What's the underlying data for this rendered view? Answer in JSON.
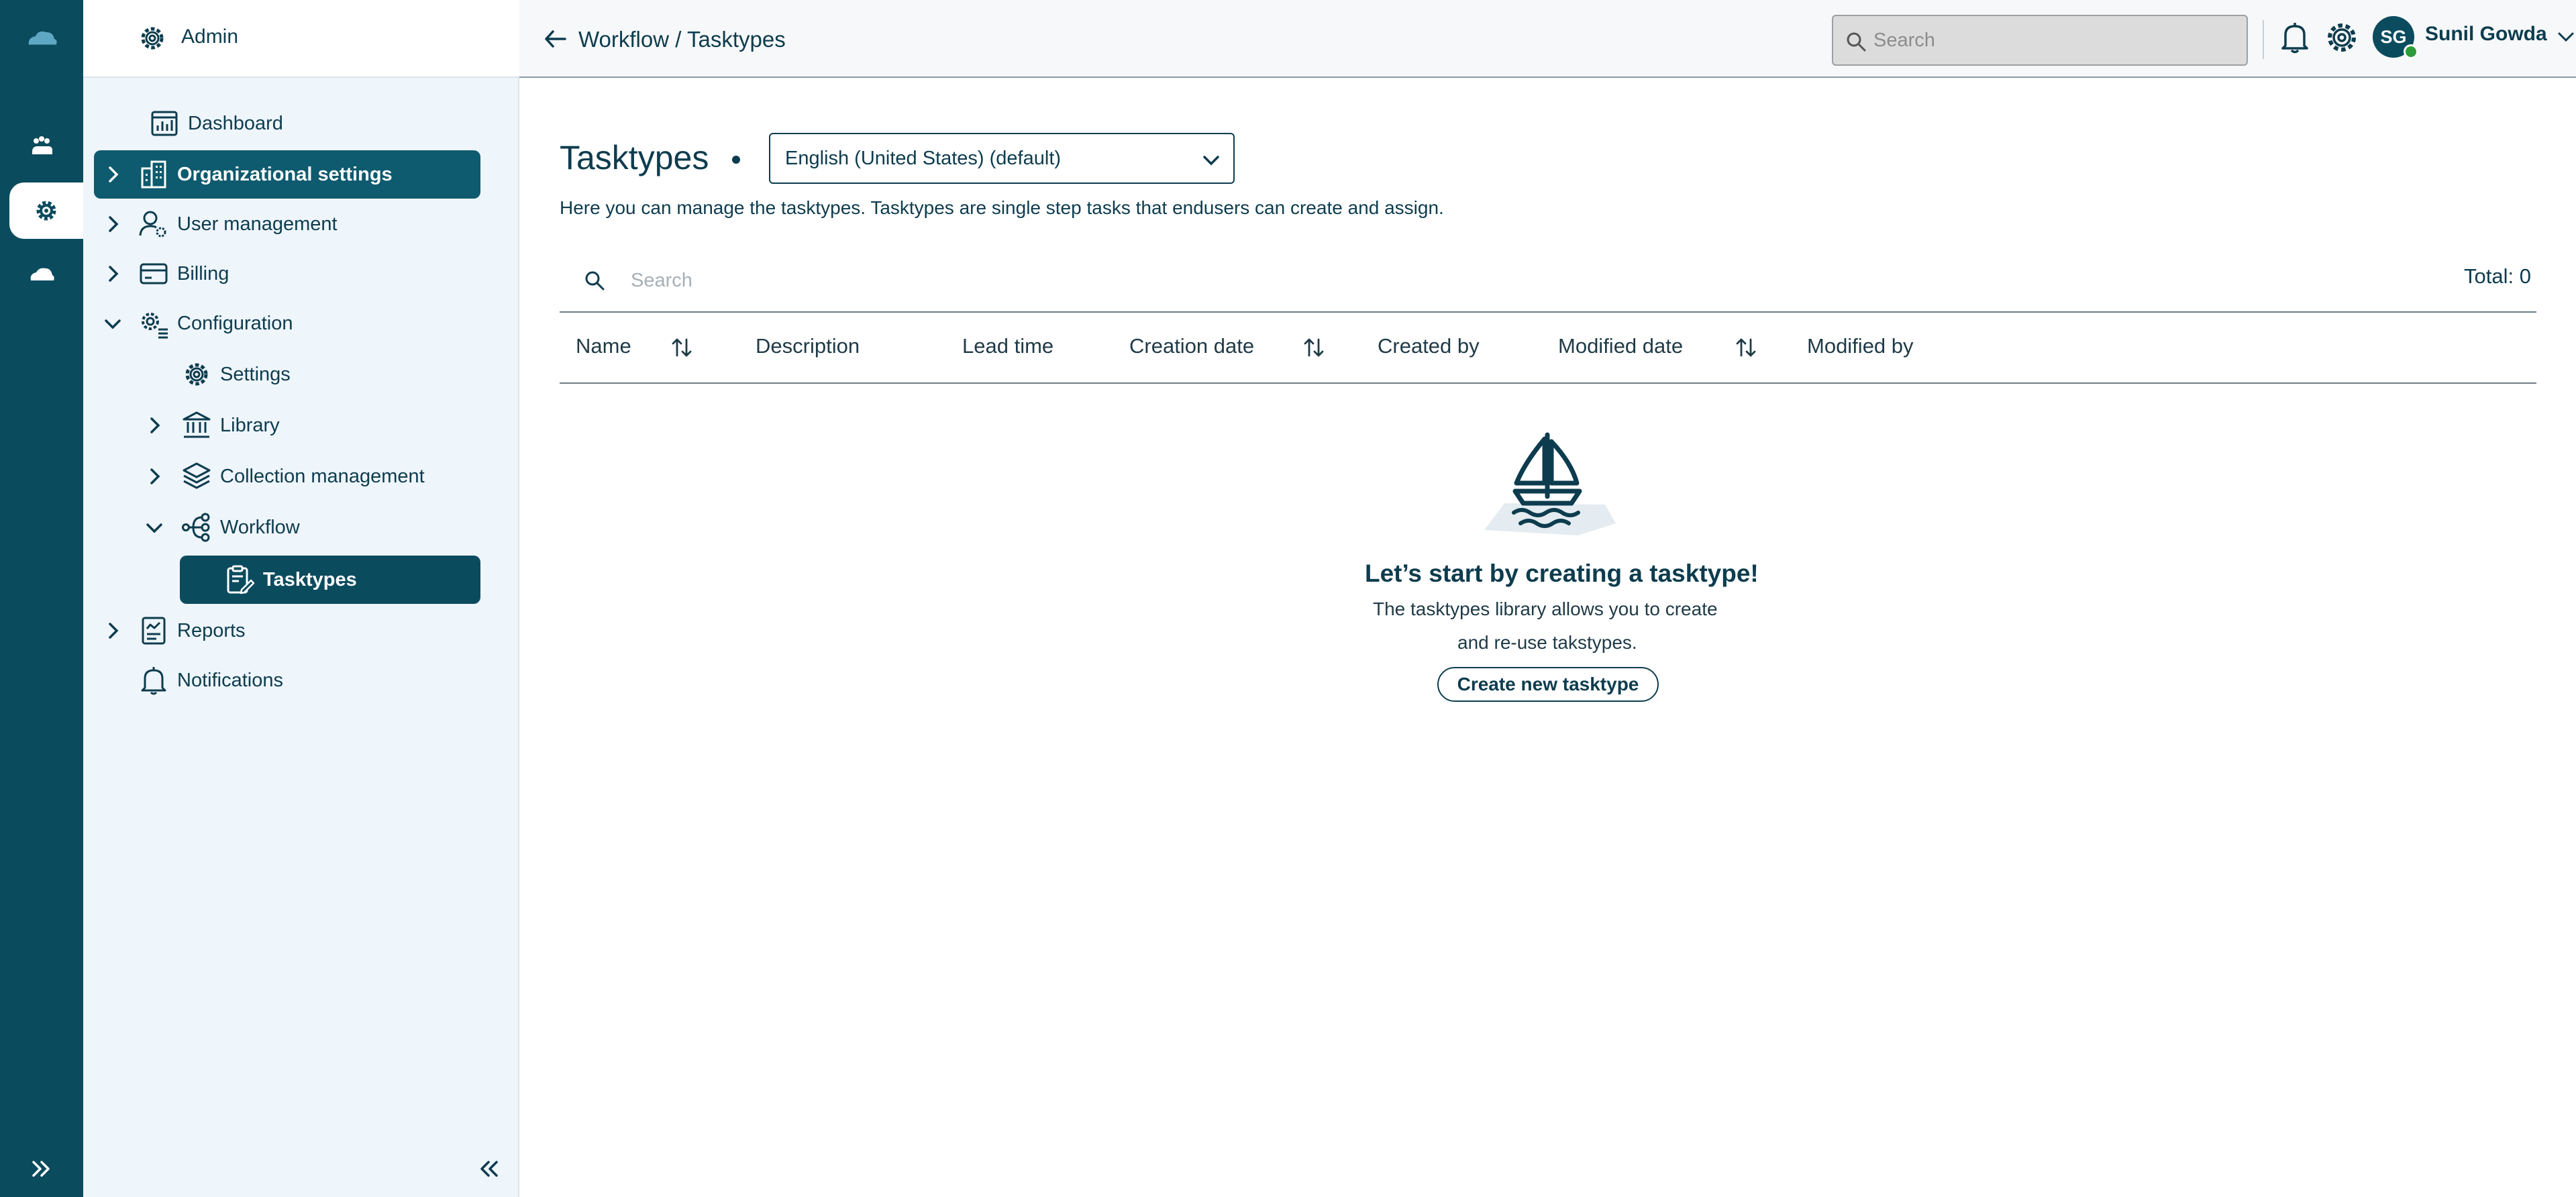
{
  "app": {
    "colors": {
      "primary": "#0b4b5e",
      "sidebar_bg": "#eef5fb",
      "presence": "#2e9c3a"
    }
  },
  "sidebar": {
    "header_title": "Admin",
    "items": [
      {
        "label": "Dashboard",
        "icon": "dashboard-icon"
      },
      {
        "label": "Organizational settings",
        "icon": "building-icon"
      },
      {
        "label": "User management",
        "icon": "user-gear-icon"
      },
      {
        "label": "Billing",
        "icon": "credit-card-icon"
      },
      {
        "label": "Configuration",
        "icon": "gear-list-icon"
      },
      {
        "label": "Settings",
        "icon": "gear-icon"
      },
      {
        "label": "Library",
        "icon": "library-icon"
      },
      {
        "label": "Collection management",
        "icon": "layers-icon"
      },
      {
        "label": "Workflow",
        "icon": "workflow-icon"
      },
      {
        "label": "Tasktypes",
        "icon": "clipboard-edit-icon"
      },
      {
        "label": "Reports",
        "icon": "report-icon"
      },
      {
        "label": "Notifications",
        "icon": "bell-icon"
      }
    ]
  },
  "topbar": {
    "breadcrumb_parent": "Workflow",
    "breadcrumb_sep": " / ",
    "breadcrumb_current": "Tasktypes",
    "search_placeholder": "Search",
    "user_initials": "SG",
    "user_name": "Sunil Gowda"
  },
  "main": {
    "title": "Tasktypes",
    "language_selected": "English (United States) (default)",
    "description": "Here you can manage the tasktypes. Tasktypes are single step tasks that endusers can create and assign.",
    "search_placeholder": "Search",
    "total_label": "Total: 0",
    "columns": [
      "Name",
      "Description",
      "Lead time",
      "Creation date",
      "Created by",
      "Modified date",
      "Modified by"
    ],
    "empty": {
      "title": "Let’s start by creating a tasktype!",
      "line1": "The tasktypes library allows you to create",
      "line2": "and re-use takstypes.",
      "button": "Create new tasktype"
    }
  }
}
